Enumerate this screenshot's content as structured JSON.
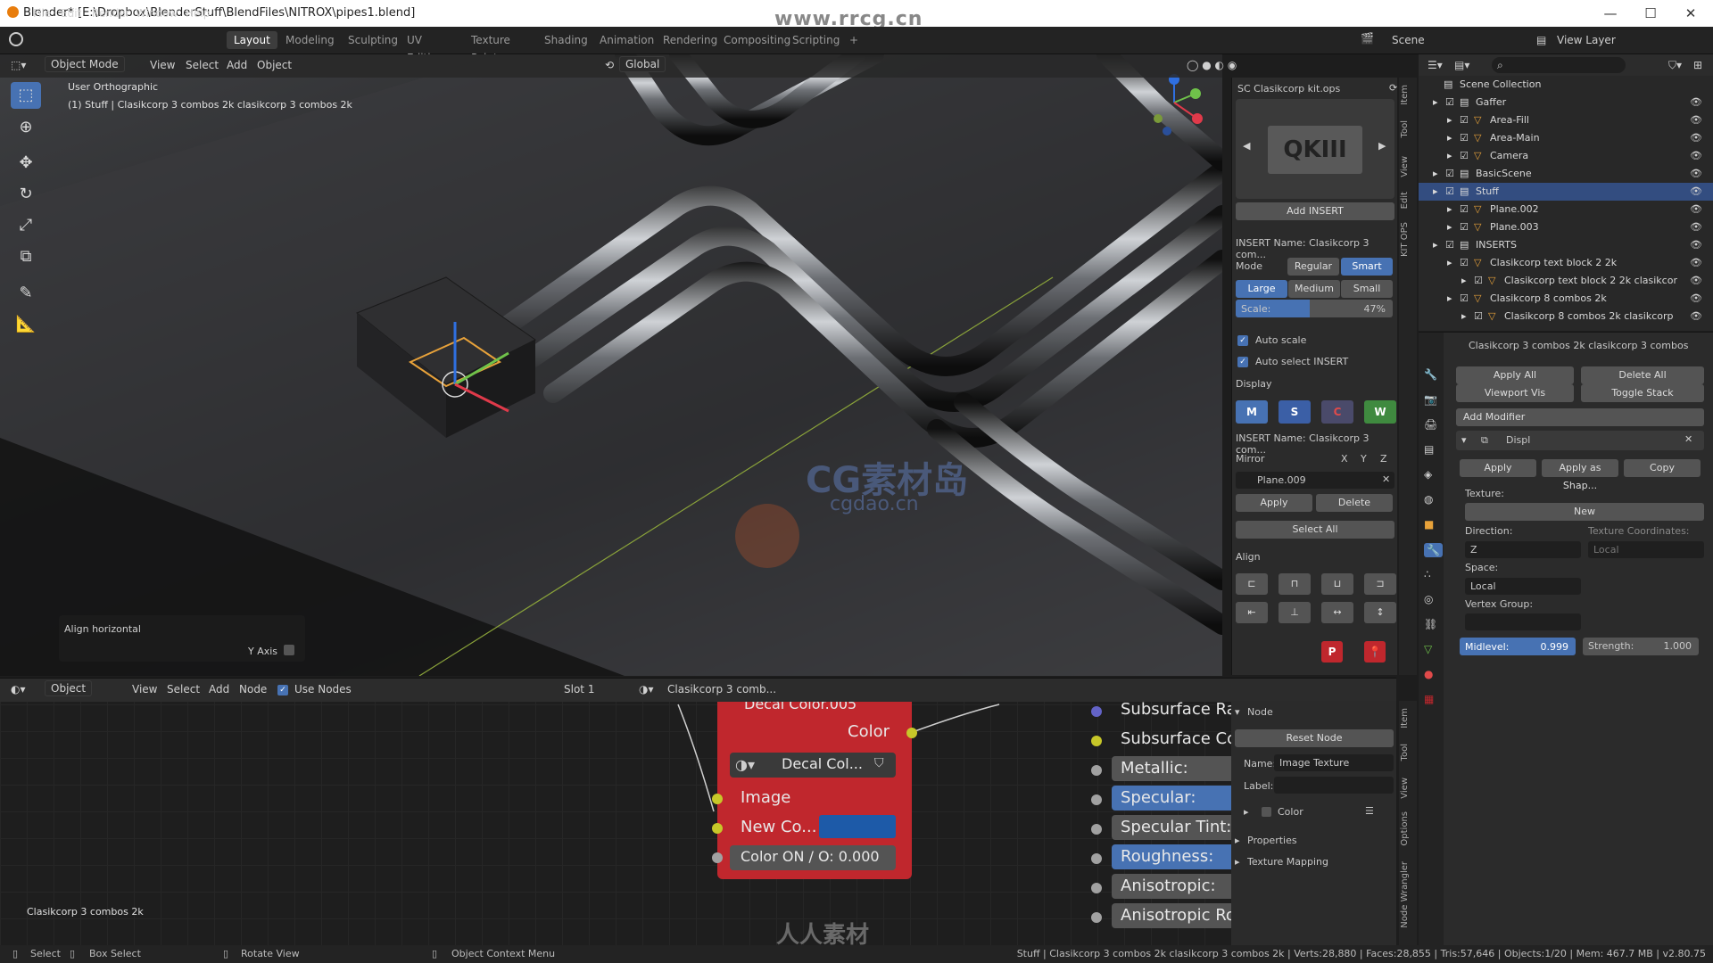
{
  "titlebar": {
    "title": "Blender* [E:\\Dropbox\\BlenderStuff\\BlendFiles\\NITROX\\pipes1.blend]",
    "minimize": "—",
    "maximize": "☐",
    "close": "✕"
  },
  "watermark_top": "www.rrcg.cn",
  "menu": {
    "items": [
      "File",
      "Edit",
      "Render",
      "Window",
      "Help"
    ]
  },
  "workspaces": [
    "Layout",
    "Modeling",
    "Sculpting",
    "UV Editing",
    "Texture Paint",
    "Shading",
    "Animation",
    "Rendering",
    "Compositing",
    "Scripting"
  ],
  "workspace_add": "+",
  "scene": {
    "scene_label": "Scene",
    "view_layer_label": "View Layer"
  },
  "viewport_header": {
    "mode": "Object Mode",
    "menus": [
      "View",
      "Select",
      "Add",
      "Object"
    ],
    "orientation": "Global"
  },
  "viewport": {
    "view_name": "User Orthographic",
    "object_info": "(1) Stuff | Clasikcorp  3 combos  2k clasikcorp  3 combos  2k",
    "redo_title": "Align horizontal",
    "redo_option": "Y Axis",
    "watermark_logo": "CG素材岛",
    "watermark_url": "cgdao.cn"
  },
  "npanel": {
    "header": "SC Clasikcorp  kit.ops",
    "thumb_text": "QKIII",
    "add_insert": "Add INSERT",
    "insert_name": "INSERT Name: Clasikcorp  3 com...",
    "mode_label": "Mode",
    "mode_regular": "Regular",
    "mode_smart": "Smart",
    "size_large": "Large",
    "size_medium": "Medium",
    "size_small": "Small",
    "scale_label": "Scale:",
    "scale_value": "47%",
    "scale_percent": 47,
    "auto_scale": "Auto scale",
    "auto_select": "Auto select INSERT",
    "display_label": "Display",
    "display_m": "M",
    "display_s": "S",
    "display_c": "C",
    "display_w": "W",
    "insert_name2": "INSERT Name: Clasikcorp  3 com...",
    "mirror_label": "Mirror",
    "mirror_x": "X",
    "mirror_y": "Y",
    "mirror_z": "Z",
    "mirror_object": "Plane.009",
    "apply": "Apply",
    "delete": "Delete",
    "select_all": "Select All",
    "align_label": "Align",
    "p_button": "P",
    "tabs": [
      "Item",
      "Tool",
      "View",
      "Edit",
      "KIT OPS"
    ]
  },
  "outliner": {
    "root": "Scene Collection",
    "rows": [
      {
        "label": "Gaffer",
        "depth": 1,
        "selected": false
      },
      {
        "label": "Area-Fill",
        "depth": 2,
        "selected": false
      },
      {
        "label": "Area-Main",
        "depth": 2,
        "selected": false
      },
      {
        "label": "Camera",
        "depth": 2,
        "selected": false
      },
      {
        "label": "BasicScene",
        "depth": 1,
        "selected": false
      },
      {
        "label": "Stuff",
        "depth": 1,
        "selected": true
      },
      {
        "label": "Plane.002",
        "depth": 2,
        "selected": false
      },
      {
        "label": "Plane.003",
        "depth": 2,
        "selected": false
      },
      {
        "label": "INSERTS",
        "depth": 1,
        "selected": false
      },
      {
        "label": "Clasikcorp  text block 2  2k",
        "depth": 2,
        "selected": false
      },
      {
        "label": "Clasikcorp  text block 2  2k clasikcor",
        "depth": 3,
        "selected": false
      },
      {
        "label": "Clasikcorp  8 combos  2k",
        "depth": 2,
        "selected": false
      },
      {
        "label": "Clasikcorp  8 combos  2k clasikcorp",
        "depth": 3,
        "selected": false
      }
    ]
  },
  "properties": {
    "object_path": "Clasikcorp  3 combos  2k clasikcorp  3 combos",
    "apply_all": "Apply All",
    "delete_all": "Delete All",
    "viewport_vis": "Viewport Vis",
    "toggle_stack": "Toggle Stack",
    "add_modifier": "Add Modifier",
    "modifier_name": "Displ",
    "mod_apply": "Apply",
    "mod_apply_shape": "Apply as Shap...",
    "mod_copy": "Copy",
    "texture_label": "Texture:",
    "new_btn": "New",
    "direction_label": "Direction:",
    "direction_value": "Z",
    "tex_coords_label": "Texture Coordinates:",
    "tex_coords_value": "Local",
    "space_label": "Space:",
    "space_value": "Local",
    "vgroup_label": "Vertex Group:",
    "midlevel_label": "Midlevel:",
    "midlevel_value": "0.999",
    "strength_label": "Strength:",
    "strength_value": "1.000"
  },
  "node_header": {
    "mode": "Object",
    "menus": [
      "View",
      "Select",
      "Add",
      "Node"
    ],
    "use_nodes": "Use Nodes",
    "slot": "Slot 1",
    "material": "Clasikcorp  3 comb..."
  },
  "nodes": {
    "decal_header": "Decal Color.005",
    "color_out": "Color",
    "decal_image": "Decal Col...",
    "image_in": "Image",
    "new_color": "New Co...",
    "color_onoff": "Color ON / O: 0.000",
    "bsdf_inputs": [
      "Subsurface Rad",
      "Subsurface Col",
      "Metallic:",
      "Specular:",
      "Specular Tint:",
      "Roughness:",
      "Anisotropic:",
      "Anisotropic Ro"
    ],
    "active_object_label": "Clasikcorp  3 combos  2k"
  },
  "node_npanel": {
    "node_title": "Node",
    "reset_node": "Reset Node",
    "name_label": "Name:",
    "name_value": "Image Texture",
    "label_label": "Label:",
    "color_label": "Color",
    "properties": "Properties",
    "texture_mapping": "Texture Mapping",
    "tabs": [
      "Item",
      "Tool",
      "View",
      "Options",
      "Node Wrangler"
    ]
  },
  "watermark_bottom": "人人素材",
  "statusbar": {
    "select": "Select",
    "box_select": "Box Select",
    "rotate": "Rotate View",
    "context": "Object Context Menu",
    "stats": "Stuff | Clasikcorp  3 combos  2k clasikcorp  3 combos  2k | Verts:28,880 | Faces:28,855 | Tris:57,646 | Objects:1/20 | Mem: 467.7 MB | v2.80.75"
  },
  "colors": {
    "accent": "#4772b3",
    "outliner_selected": "#334d80",
    "decal_node": "#c0272d",
    "socket_yellow": "#c7c729",
    "socket_gray": "#a1a1a1",
    "socket_purple": "#6363c7"
  }
}
